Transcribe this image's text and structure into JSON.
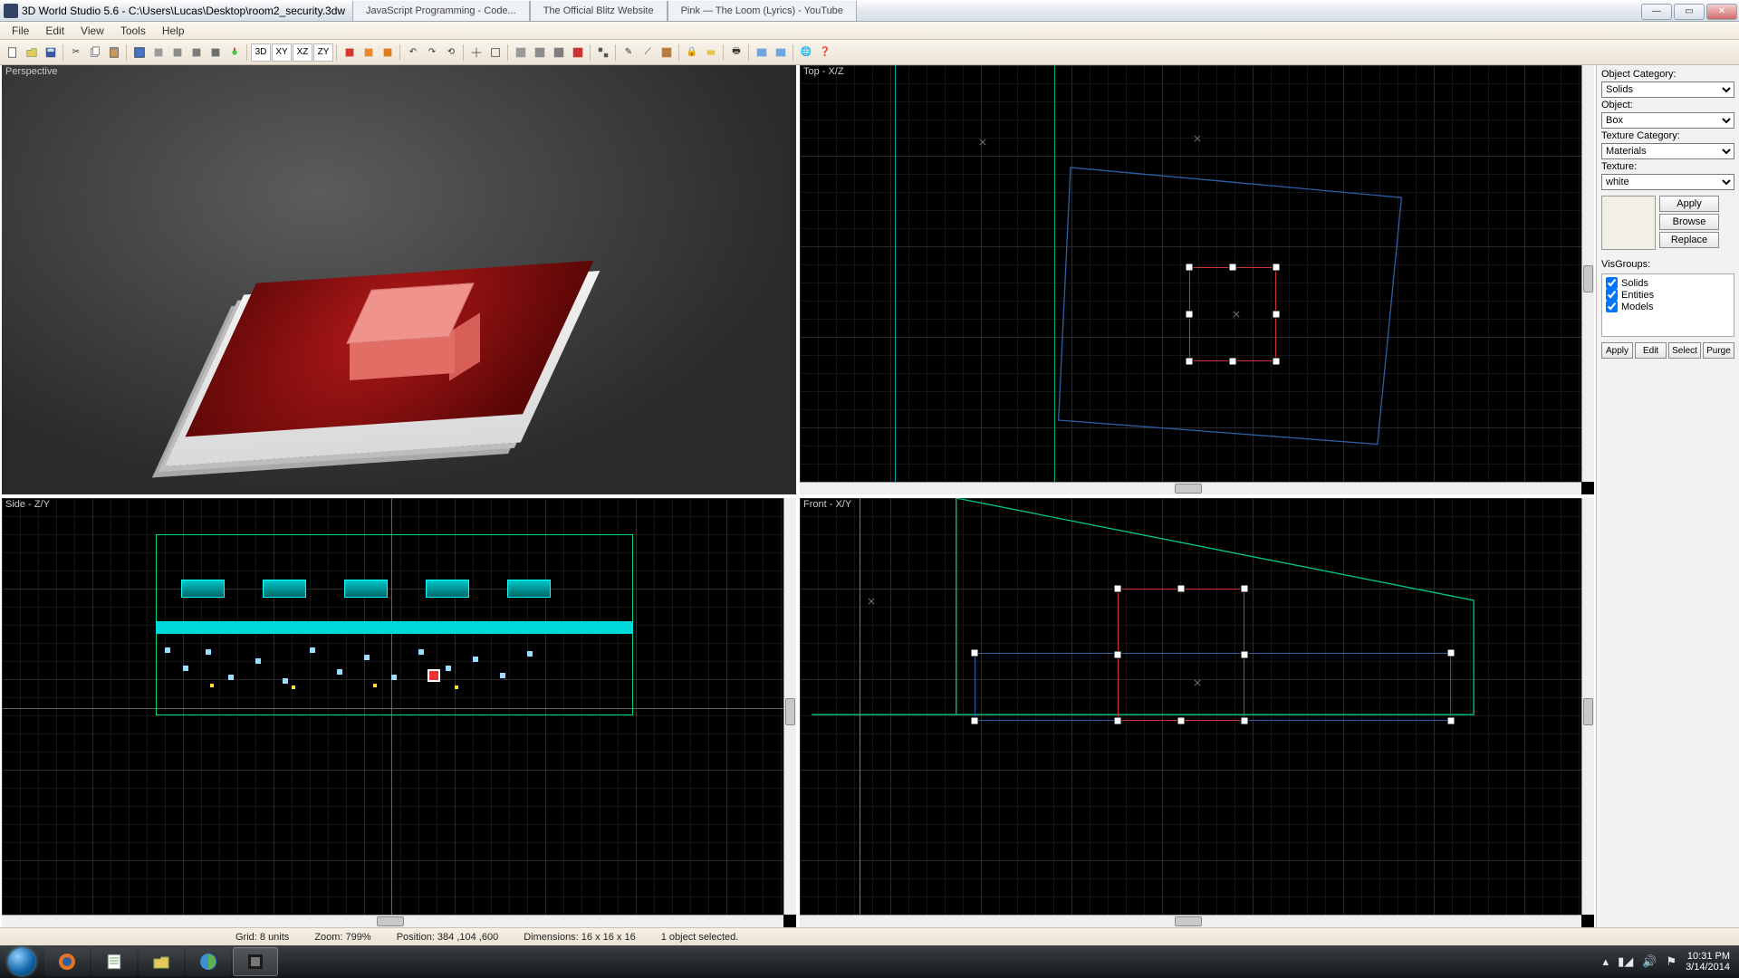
{
  "app": {
    "title": "3D World Studio 5.6 - C:\\Users\\Lucas\\Desktop\\room2_security.3dw",
    "browser_tabs": [
      "JavaScript Programming - Code...",
      "The Official Blitz Website",
      "Pink — The Loom (Lyrics) - YouTube"
    ]
  },
  "menu": {
    "file": "File",
    "edit": "Edit",
    "view": "View",
    "tools": "Tools",
    "help": "Help"
  },
  "toolbar": {
    "btn_3d": "3D",
    "btn_xy": "XY",
    "btn_xz": "XZ",
    "btn_zy": "ZY"
  },
  "viewports": {
    "persp": "Perspective",
    "top": "Top - X/Z",
    "side": "Side - Z/Y",
    "front": "Front - X/Y"
  },
  "panel": {
    "object_category_label": "Object Category:",
    "object_category_value": "Solids",
    "object_label": "Object:",
    "object_value": "Box",
    "texture_category_label": "Texture Category:",
    "texture_category_value": "Materials",
    "texture_label": "Texture:",
    "texture_value": "white",
    "apply": "Apply",
    "browse": "Browse",
    "replace": "Replace",
    "visgroups_label": "VisGroups:",
    "vg_solids": "Solids",
    "vg_entities": "Entities",
    "vg_models": "Models",
    "btn_apply": "Apply",
    "btn_edit": "Edit",
    "btn_select": "Select",
    "btn_purge": "Purge"
  },
  "status": {
    "grid": "Grid: 8 units",
    "zoom": "Zoom: 799%",
    "position": "Position: 384 ,104 ,600",
    "dimensions": "Dimensions: 16 x 16 x 16",
    "selection": "1 object selected."
  },
  "tray": {
    "time": "10:31 PM",
    "date": "3/14/2014"
  }
}
